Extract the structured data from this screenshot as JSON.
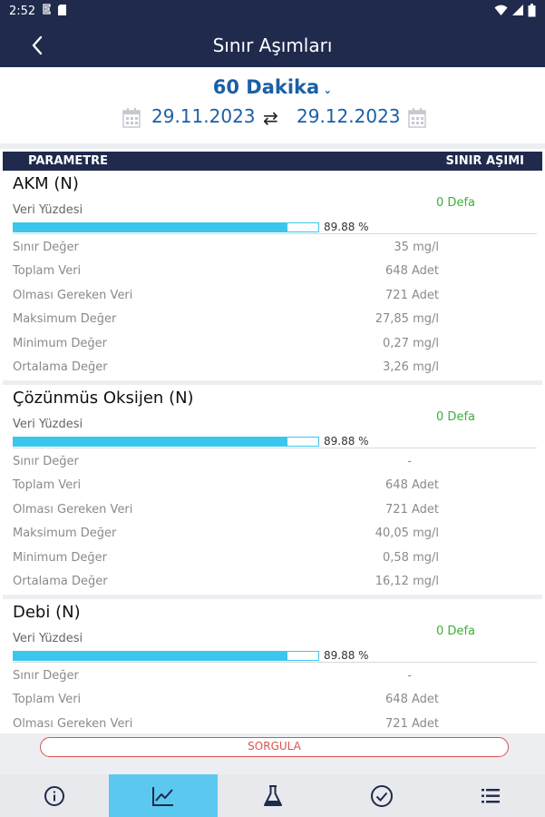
{
  "status_bar": {
    "time": "2:52"
  },
  "app_bar": {
    "title": "Sınır Aşımları"
  },
  "filter": {
    "period": "60 Dakika",
    "start_date": "29.11.2023",
    "end_date": "29.12.2023"
  },
  "table_header": {
    "parameter": "PARAMETRE",
    "limit_exceed": "SINIR AŞIMI"
  },
  "cards": [
    {
      "name": "AKM (N)",
      "data_percent_label": "Veri Yüzdesi",
      "exceed_count": "0 Defa",
      "percent_value": 89.88,
      "percent_text": "89.88 %",
      "rows": [
        {
          "label": "Sınır Değer",
          "value": "35 mg/l"
        },
        {
          "label": "Toplam Veri",
          "value": "648  Adet"
        },
        {
          "label": "Olması Gereken Veri",
          "value": "721  Adet"
        },
        {
          "label": "Maksimum Değer",
          "value": "27,85 mg/l"
        },
        {
          "label": "Minimum Değer",
          "value": "0,27 mg/l"
        },
        {
          "label": "Ortalama Değer",
          "value": "3,26 mg/l"
        }
      ]
    },
    {
      "name": "Çözünmüs Oksijen (N)",
      "data_percent_label": "Veri Yüzdesi",
      "exceed_count": "0 Defa",
      "percent_value": 89.88,
      "percent_text": "89.88 %",
      "rows": [
        {
          "label": "Sınır Değer",
          "value": "-"
        },
        {
          "label": "Toplam Veri",
          "value": "648  Adet"
        },
        {
          "label": "Olması Gereken Veri",
          "value": "721  Adet"
        },
        {
          "label": "Maksimum Değer",
          "value": "40,05 mg/l"
        },
        {
          "label": "Minimum Değer",
          "value": "0,58 mg/l"
        },
        {
          "label": "Ortalama Değer",
          "value": "16,12 mg/l"
        }
      ]
    },
    {
      "name": "Debi (N)",
      "data_percent_label": "Veri Yüzdesi",
      "exceed_count": "0 Defa",
      "percent_value": 89.88,
      "percent_text": "89.88 %",
      "rows": [
        {
          "label": "Sınır Değer",
          "value": "-"
        },
        {
          "label": "Toplam Veri",
          "value": "648  Adet"
        },
        {
          "label": "Olması Gereken Veri",
          "value": "721  Adet"
        }
      ]
    }
  ],
  "query_button": {
    "label": "SORGULA"
  },
  "bottom_nav": [
    {
      "icon": "info-icon",
      "active": false
    },
    {
      "icon": "chart-line-icon",
      "active": true
    },
    {
      "icon": "flask-icon",
      "active": false
    },
    {
      "icon": "check-circle-icon",
      "active": false
    },
    {
      "icon": "list-icon",
      "active": false
    }
  ],
  "colors": {
    "primary_dark": "#1f2a4d",
    "accent_blue": "#1b5fa6",
    "progress": "#3cc6ee",
    "success": "#3ab03a",
    "danger": "#d9534f",
    "nav_active": "#5bc8f0"
  }
}
